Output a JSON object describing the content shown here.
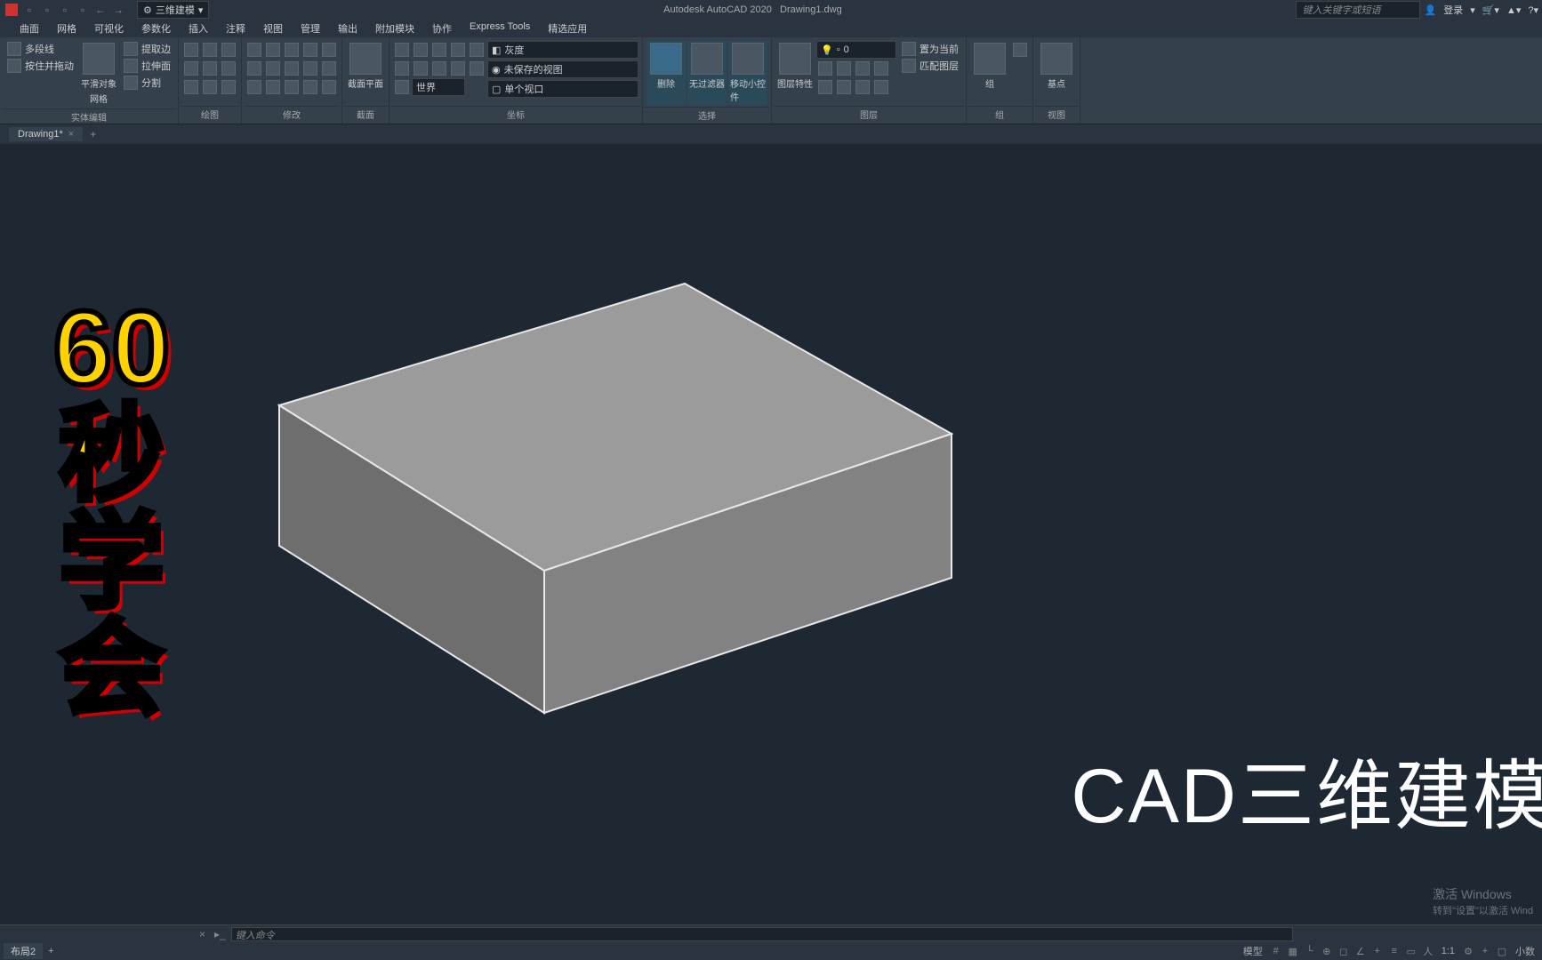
{
  "title": {
    "app": "Autodesk AutoCAD 2020",
    "file": "Drawing1.dwg"
  },
  "workspace": "三维建模",
  "search_ph": "键入关键字或短语",
  "login": "登录",
  "menutabs": [
    "曲面",
    "网格",
    "可视化",
    "参数化",
    "插入",
    "注释",
    "视图",
    "管理",
    "输出",
    "附加模块",
    "协作",
    "Express Tools",
    "精选应用"
  ],
  "ribbon": {
    "p1": {
      "title": "实体编辑",
      "polyline": "多段线",
      "press": "按住并拖动",
      "smooth": "平滑对象",
      "mesh": "网格",
      "extract": "提取边",
      "extrude": "拉伸面",
      "split": "分割"
    },
    "p2": {
      "title": "绘图"
    },
    "p3": {
      "title": "修改"
    },
    "p4": {
      "title": "截面",
      "sec": "截面平面"
    },
    "p5": {
      "title": "坐标",
      "d1": "灰度",
      "d2": "未保存的视图",
      "d3": "世界",
      "d4": "单个视口"
    },
    "p6": {
      "title": "选择",
      "del": "删除",
      "nofilter": "无过滤器",
      "move": "移动小控件"
    },
    "p7": {
      "title": "图层",
      "prop": "图层特性",
      "layer0": "0",
      "cur": "置为当前",
      "match": "匹配图层"
    },
    "p8": {
      "title": "组",
      "grp": "组"
    },
    "p9": {
      "title": "视图",
      "base": "基点"
    }
  },
  "filetab": "Drawing1*",
  "overlay": {
    "left": [
      "60",
      "秒",
      "学",
      "会"
    ],
    "right": "CAD三维建模"
  },
  "watermark": {
    "l1": "激活 Windows",
    "l2": "转到\"设置\"以激活 Wind"
  },
  "cmd_ph": "键入命令",
  "layouts": [
    "布局2"
  ],
  "status": {
    "model": "模型",
    "ratio": "1:1",
    "dec": "小数"
  }
}
